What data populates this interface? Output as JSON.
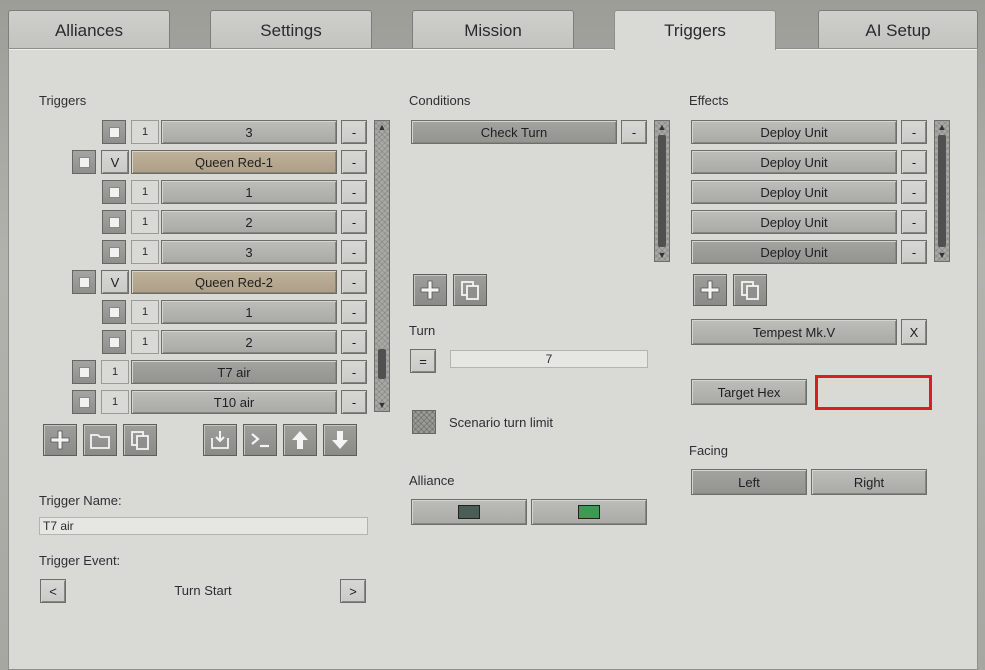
{
  "tabs": [
    {
      "label": "Alliances"
    },
    {
      "label": "Settings"
    },
    {
      "label": "Mission"
    },
    {
      "label": "Triggers"
    },
    {
      "label": "AI Setup"
    }
  ],
  "triggers": {
    "heading": "Triggers",
    "rows": [
      {
        "num": "1",
        "label": "3",
        "remove": "-"
      },
      {
        "num": "V",
        "label": "Queen Red-1",
        "remove": "-"
      },
      {
        "num": "1",
        "label": "1",
        "remove": "-"
      },
      {
        "num": "1",
        "label": "2",
        "remove": "-"
      },
      {
        "num": "1",
        "label": "3",
        "remove": "-"
      },
      {
        "num": "V",
        "label": "Queen Red-2",
        "remove": "-"
      },
      {
        "num": "1",
        "label": "1",
        "remove": "-"
      },
      {
        "num": "1",
        "label": "2",
        "remove": "-"
      },
      {
        "num": "1",
        "label": "T7 air",
        "remove": "-"
      },
      {
        "num": "1",
        "label": "T10 air",
        "remove": "-"
      }
    ],
    "name_label": "Trigger Name:",
    "name_value": "T7 air",
    "event_label": "Trigger Event:",
    "event_prev": "<",
    "event_value": "Turn Start",
    "event_next": ">"
  },
  "conditions": {
    "heading": "Conditions",
    "items": [
      {
        "label": "Check Turn",
        "remove": "-"
      }
    ],
    "turn_label": "Turn",
    "turn_op": "=",
    "turn_value": "7",
    "scenario_limit_label": "Scenario turn limit",
    "alliance_label": "Alliance",
    "alliance_colors": [
      "#4a5e55",
      "#3c9a52"
    ]
  },
  "effects": {
    "heading": "Effects",
    "items": [
      {
        "label": "Deploy Unit",
        "remove": "-"
      },
      {
        "label": "Deploy Unit",
        "remove": "-"
      },
      {
        "label": "Deploy Unit",
        "remove": "-"
      },
      {
        "label": "Deploy Unit",
        "remove": "-"
      },
      {
        "label": "Deploy Unit",
        "remove": "-"
      }
    ],
    "unit_name": "Tempest Mk.V",
    "unit_clear": "X",
    "target_hex_label": "Target Hex",
    "target_hex_value": "",
    "facing_label": "Facing",
    "facing_left": "Left",
    "facing_right": "Right"
  }
}
